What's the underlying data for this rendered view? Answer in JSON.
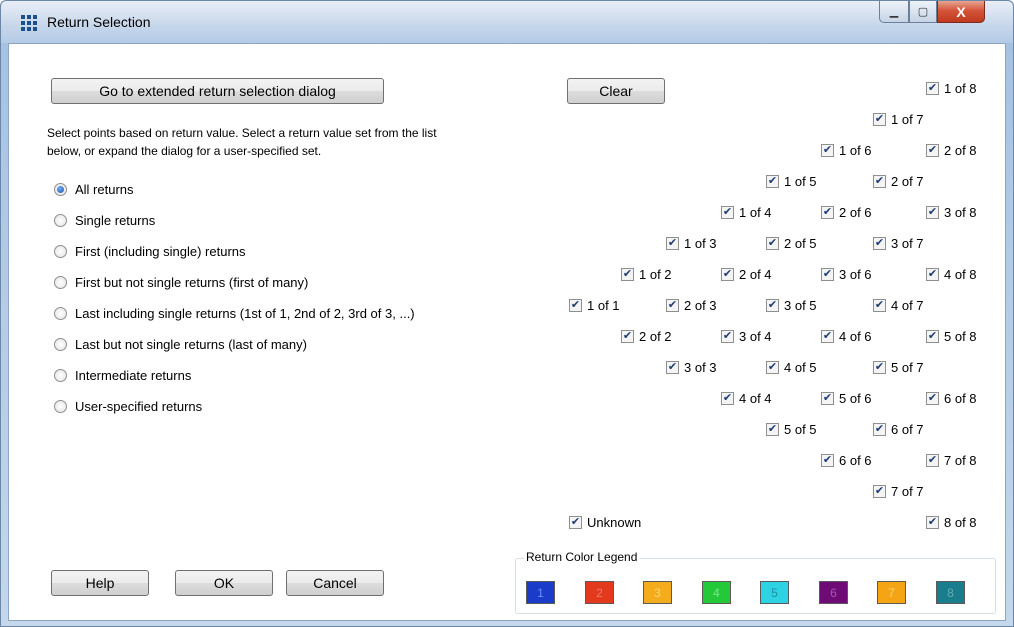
{
  "window": {
    "title": "Return Selection",
    "controls": {
      "minimize": "▁",
      "maximize": "▢",
      "close": "X"
    },
    "icon": "grid-icon"
  },
  "buttons": {
    "extended": "Go to extended return selection dialog",
    "clear": "Clear",
    "help": "Help",
    "ok": "OK",
    "cancel": "Cancel"
  },
  "description": [
    "Select points based on return value.  Select a return value set from the list",
    "below, or expand the dialog for a user-specified set."
  ],
  "radios": [
    {
      "label": "All returns",
      "selected": true
    },
    {
      "label": "Single returns",
      "selected": false
    },
    {
      "label": "First (including single) returns",
      "selected": false
    },
    {
      "label": "First but not single returns (first of many)",
      "selected": false
    },
    {
      "label": "Last including single returns (1st of 1, 2nd of 2, 3rd of 3, ...)",
      "selected": false
    },
    {
      "label": "Last but not single returns (last of many)",
      "selected": false
    },
    {
      "label": "Intermediate returns",
      "selected": false
    },
    {
      "label": "User-specified returns",
      "selected": false
    }
  ],
  "checkboxes": [
    {
      "label": "1 of 1",
      "checked": true
    },
    {
      "label": "1 of 2",
      "checked": true
    },
    {
      "label": "2 of 2",
      "checked": true
    },
    {
      "label": "1 of 3",
      "checked": true
    },
    {
      "label": "2 of 3",
      "checked": true
    },
    {
      "label": "3 of 3",
      "checked": true
    },
    {
      "label": "1 of 4",
      "checked": true
    },
    {
      "label": "2 of 4",
      "checked": true
    },
    {
      "label": "3 of 4",
      "checked": true
    },
    {
      "label": "4 of 4",
      "checked": true
    },
    {
      "label": "1 of 5",
      "checked": true
    },
    {
      "label": "2 of 5",
      "checked": true
    },
    {
      "label": "3 of 5",
      "checked": true
    },
    {
      "label": "4 of 5",
      "checked": true
    },
    {
      "label": "5 of 5",
      "checked": true
    },
    {
      "label": "1 of 6",
      "checked": true
    },
    {
      "label": "2 of 6",
      "checked": true
    },
    {
      "label": "3 of 6",
      "checked": true
    },
    {
      "label": "4 of 6",
      "checked": true
    },
    {
      "label": "5 of 6",
      "checked": true
    },
    {
      "label": "6 of 6",
      "checked": true
    },
    {
      "label": "1 of 7",
      "checked": true
    },
    {
      "label": "2 of 7",
      "checked": true
    },
    {
      "label": "3 of 7",
      "checked": true
    },
    {
      "label": "4 of 7",
      "checked": true
    },
    {
      "label": "5 of 7",
      "checked": true
    },
    {
      "label": "6 of 7",
      "checked": true
    },
    {
      "label": "7 of 7",
      "checked": true
    },
    {
      "label": "1 of 8",
      "checked": true
    },
    {
      "label": "2 of 8",
      "checked": true
    },
    {
      "label": "3 of 8",
      "checked": true
    },
    {
      "label": "4 of 8",
      "checked": true
    },
    {
      "label": "5 of 8",
      "checked": true
    },
    {
      "label": "6 of 8",
      "checked": true
    },
    {
      "label": "7 of 8",
      "checked": true
    },
    {
      "label": "8 of 8",
      "checked": true
    },
    {
      "label": "Unknown",
      "checked": true
    }
  ],
  "legend": {
    "title": "Return Color Legend",
    "items": [
      {
        "label": "1",
        "color": "#1a3cc8",
        "text_color": "#6f8cff"
      },
      {
        "label": "2",
        "color": "#e33a1d",
        "text_color": "#f07a62"
      },
      {
        "label": "3",
        "color": "#f2ac1c",
        "text_color": "#f8d27e"
      },
      {
        "label": "4",
        "color": "#24c93a",
        "text_color": "#7fe48b"
      },
      {
        "label": "5",
        "color": "#2ed3e3",
        "text_color": "#1c8fa0"
      },
      {
        "label": "6",
        "color": "#6e0b77",
        "text_color": "#a35aab"
      },
      {
        "label": "7",
        "color": "#f5a514",
        "text_color": "#fbd17b"
      },
      {
        "label": "8",
        "color": "#1a7d8c",
        "text_color": "#63aab5"
      }
    ]
  }
}
